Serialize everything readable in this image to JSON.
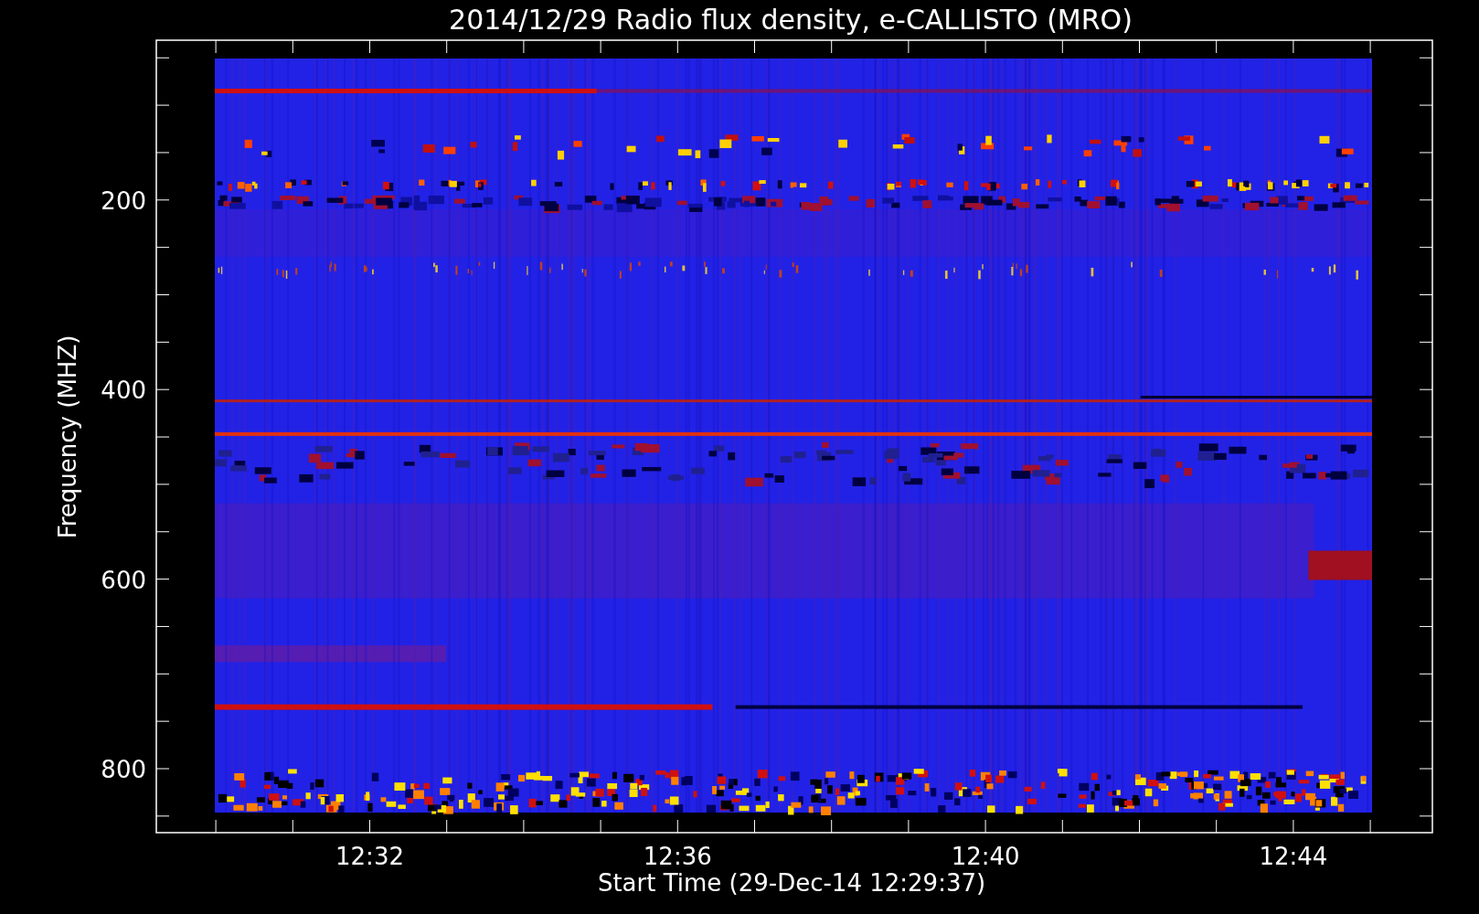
{
  "plot": {
    "title": "2014/12/29  Radio flux density, e-CALLISTO (MRO)",
    "ylabel": "Frequency (MHZ)",
    "xlabel": "Start Time (29-Dec-14 12:29:37)",
    "yticks": [
      "200",
      "400",
      "600",
      "800"
    ],
    "xticks": [
      "12:32",
      "12:36",
      "12:40",
      "12:44"
    ]
  }
}
